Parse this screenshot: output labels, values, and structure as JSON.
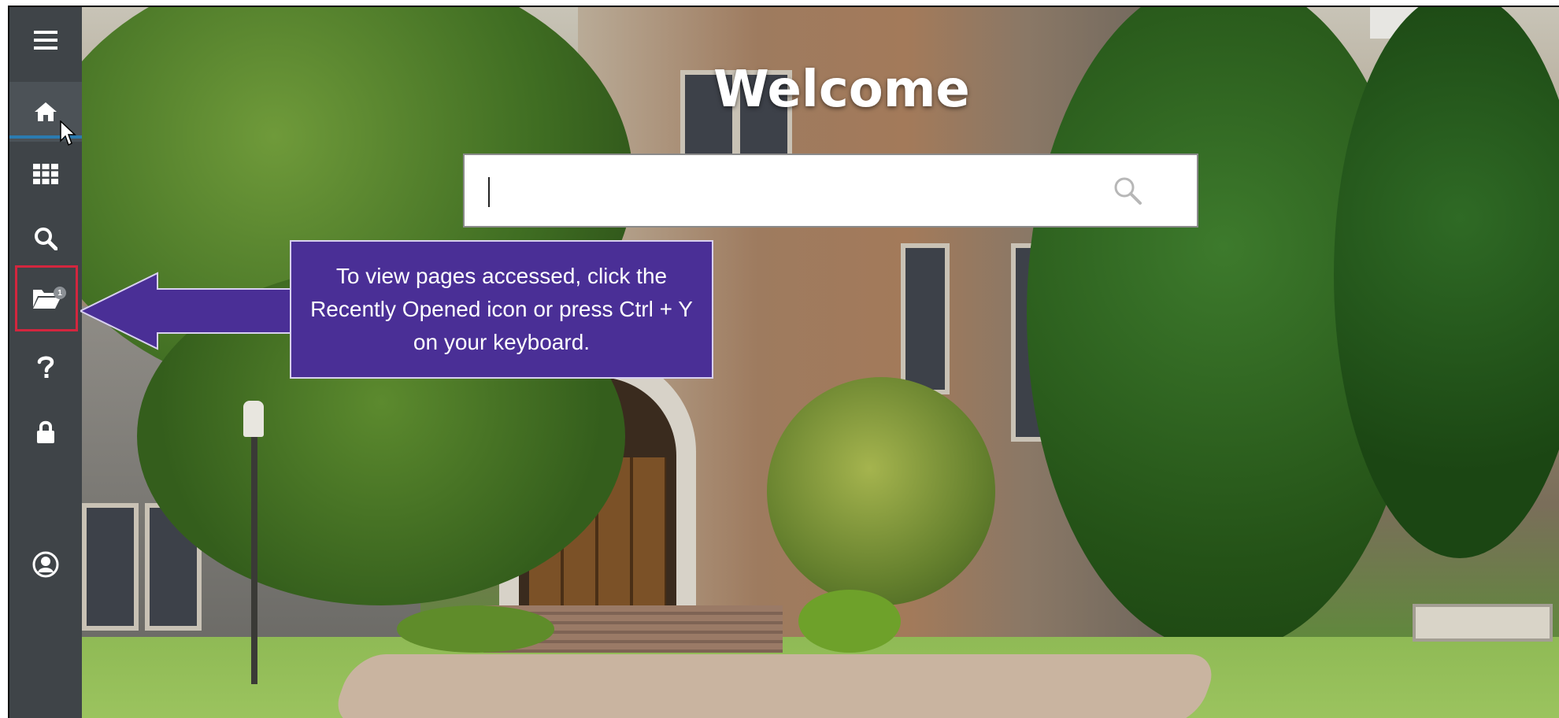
{
  "page": {
    "welcome_title": "Welcome"
  },
  "search": {
    "value": "",
    "placeholder": ""
  },
  "sidebar": {
    "items": [
      {
        "name": "menu",
        "icon": "hamburger-menu-icon"
      },
      {
        "name": "home",
        "icon": "home-icon"
      },
      {
        "name": "apps",
        "icon": "grid-icon"
      },
      {
        "name": "search",
        "icon": "search-icon"
      },
      {
        "name": "recently-opened",
        "icon": "open-folder-icon",
        "badge": "1"
      },
      {
        "name": "help",
        "icon": "question-mark-icon"
      },
      {
        "name": "lock",
        "icon": "lock-icon"
      },
      {
        "name": "user",
        "icon": "user-circle-icon"
      }
    ]
  },
  "callout": {
    "text": "To view pages accessed, click the Recently Opened icon or press Ctrl + Y on your keyboard."
  },
  "colors": {
    "sidebar_bg": "#3f4448",
    "callout_bg": "#4a2f96",
    "highlight_border": "#d3263e",
    "active_underline": "#2b7bb0"
  }
}
